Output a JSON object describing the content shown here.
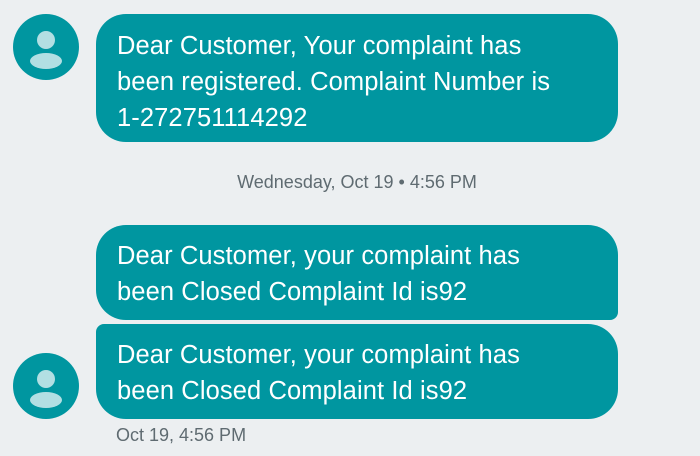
{
  "conversation": {
    "messages": [
      {
        "text": "Dear Customer, Your complaint has\nbeen registered. Complaint Number is\n1-272751114292"
      },
      {
        "text": "Dear Customer, your complaint has\nbeen Closed Complaint Id is92"
      },
      {
        "text": "Dear Customer, your complaint has\nbeen Closed Complaint Id is92"
      }
    ],
    "date_separator": "Wednesday, Oct 19 • 4:56 PM",
    "last_timestamp": "Oct 19, 4:56 PM"
  },
  "colors": {
    "background": "#eceff1",
    "bubble": "#0096a0",
    "avatar_bg": "#0096a0",
    "avatar_glyph": "#b2dfe3",
    "meta_text": "#5f6b71"
  },
  "icons": {
    "avatar": "person-icon"
  }
}
